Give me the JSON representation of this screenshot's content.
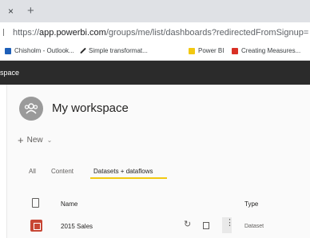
{
  "browser": {
    "tab_close_glyph": "×",
    "new_tab_glyph": "+",
    "url_scheme": "https://",
    "url_host": "app.powerbi.com",
    "url_path": "/groups/me/list/dashboards?redirectedFromSignup=",
    "bookmarks": [
      {
        "label": "Chisholm - Outlook...",
        "icon": "outlook-icon",
        "color": "#1e5fb8"
      },
      {
        "label": "Simple transformat...",
        "icon": "pencil-icon",
        "color": "#2b2b2b"
      },
      {
        "label": "Power BI",
        "icon": "powerbi-icon",
        "color": "#f2c811"
      },
      {
        "label": "Creating Measures...",
        "icon": "bookmark-icon",
        "color": "#d93025"
      }
    ]
  },
  "header": {
    "label": "space"
  },
  "workspace": {
    "title": "My workspace",
    "avatar_icon": "people-icon",
    "new_label": "New",
    "new_icon": "plus-icon",
    "new_chevron": "chevron-down-icon"
  },
  "tabs": {
    "all": "All",
    "content": "Content",
    "datasets": "Datasets + dataflows"
  },
  "table": {
    "columns": {
      "name": "Name",
      "type": "Type"
    },
    "rows": [
      {
        "name": "2015 Sales",
        "type": "Dataset",
        "icon": "dataset-icon",
        "refresh_glyph": "↻",
        "more_glyph": "⋮"
      }
    ]
  },
  "colors": {
    "accent": "#f2c811",
    "header_bg": "#2b2b2b",
    "dataset_icon": "#c74634"
  }
}
